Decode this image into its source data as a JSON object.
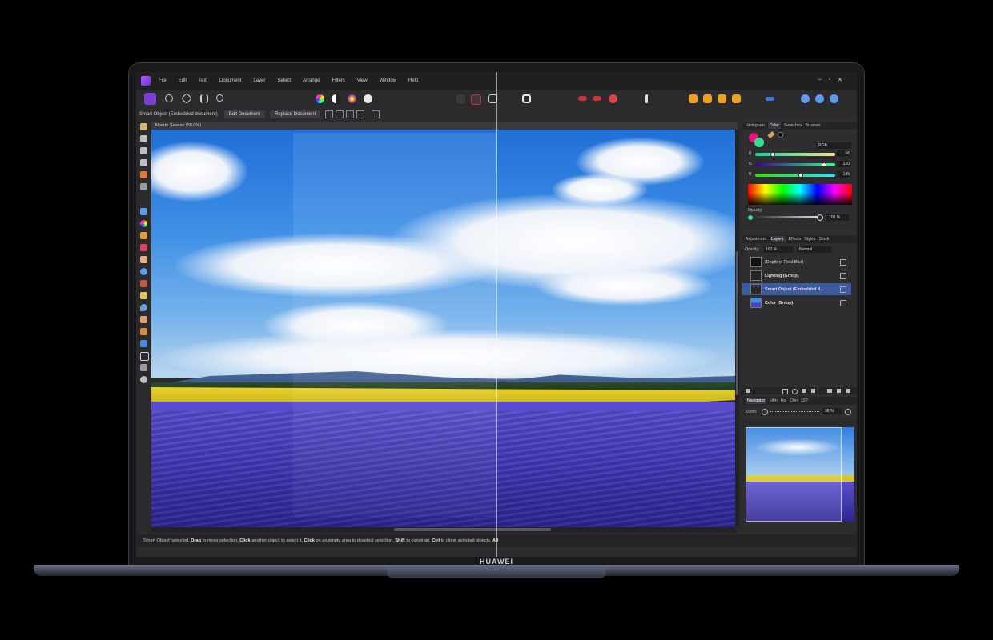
{
  "device": {
    "brand": "HUAWEI"
  },
  "app": {
    "menu": [
      "File",
      "Edit",
      "Text",
      "Document",
      "Layer",
      "Select",
      "Arrange",
      "Filters",
      "View",
      "Window",
      "Help"
    ],
    "window_controls": [
      "–",
      "▫",
      "✕"
    ]
  },
  "context_toolbar": {
    "selection_label": "Smart Object (Embedded document)",
    "edit_document": "Edit Document",
    "replace_document": "Replace Document"
  },
  "document": {
    "tab_title": "Alberto Seveso (38.0%)"
  },
  "color_panel": {
    "tabs": [
      "Histogram",
      "Color",
      "Swatches",
      "Brushes"
    ],
    "active_tab": "Color",
    "mode": "RGB",
    "r_label": "R",
    "g_label": "G",
    "b_label": "B",
    "r": "56",
    "g": "220",
    "b": "145",
    "r_level": 0.22,
    "g_level": 0.86,
    "b_level": 0.57,
    "opacity_label": "Opacity",
    "opacity": "100 %",
    "primary_color": "#e0157e",
    "secondary_color": "#38dc91"
  },
  "layers_panel": {
    "tabs": [
      "Adjustment",
      "Layers",
      "Effects",
      "Styles",
      "Stock"
    ],
    "active_tab": "Layers",
    "opacity_label": "Opacity:",
    "opacity_value": "100 %",
    "blend_mode": "Normal",
    "layers": [
      {
        "name": "(Depth of Field Blur)",
        "selected": false
      },
      {
        "name": "Lighting (Group)",
        "selected": false
      },
      {
        "name": "Smart Object (Embedded d...",
        "selected": true
      },
      {
        "name": "Color (Group)",
        "selected": false
      }
    ]
  },
  "navigator_panel": {
    "tabs": [
      "Navigator",
      "Hfm",
      "His",
      "Chn",
      "32P"
    ],
    "active_tab": "Navigator",
    "zoom_label": "Zoom:",
    "zoom_value": "38 %"
  },
  "status": {
    "quote": "'Smart Object' selected.",
    "drag": "Drag",
    "drag_text": "to move selection.",
    "click": "Click",
    "click_text": "another object to select it.",
    "click2": "Click",
    "click2_text": "on an empty area to deselect selection.",
    "shift": "Shift",
    "shift_text": "to constrain.",
    "ctrl": "Ctrl",
    "ctrl_text": "to clone selected objects.",
    "alt": "Alt"
  }
}
